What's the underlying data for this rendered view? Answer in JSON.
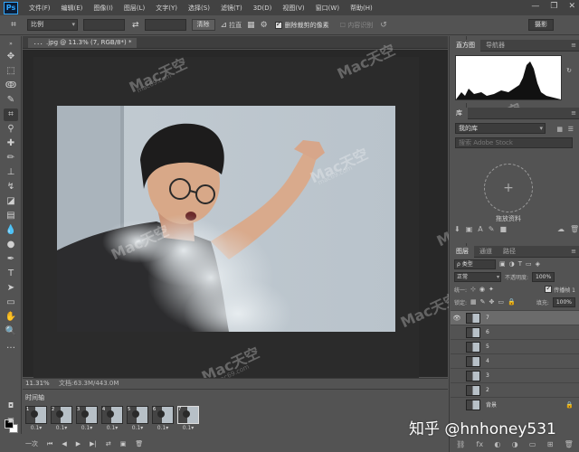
{
  "menu": {
    "logo": "Ps",
    "items": [
      "文件(F)",
      "编辑(E)",
      "图像(I)",
      "图层(L)",
      "文字(Y)",
      "选择(S)",
      "滤镜(T)",
      "3D(D)",
      "视图(V)",
      "窗口(W)",
      "帮助(H)"
    ],
    "window_buttons": [
      "—",
      "❐",
      "✕"
    ]
  },
  "options": {
    "ratio": "比例",
    "clear_label": "清除",
    "straighten_label": "拉直",
    "delete_cropped_label": "删除裁剪的像素",
    "delete_cropped_checked": true,
    "content_aware_label": "内容识别",
    "workspace": "摄影"
  },
  "document": {
    "tab_title": "．．．.jpg @ 11.3% (7, RGB/8*) *"
  },
  "status": {
    "zoom": "11.31%",
    "doc_size": "文档:63.3M/443.0M"
  },
  "timeline": {
    "tab_label": "时间轴",
    "frames": [
      {
        "num": "1",
        "delay": "0.1▾"
      },
      {
        "num": "2",
        "delay": "0.1▾"
      },
      {
        "num": "3",
        "delay": "0.1▾"
      },
      {
        "num": "4",
        "delay": "0.1▾"
      },
      {
        "num": "5",
        "delay": "0.1▾"
      },
      {
        "num": "6",
        "delay": "0.1▾"
      },
      {
        "num": "7",
        "delay": "0.1▾"
      }
    ],
    "loop": "一次",
    "controls": [
      "⏮",
      "◀",
      "▶",
      "▶|",
      "⇄",
      "▣",
      "🗑"
    ]
  },
  "histogram_panel": {
    "tabs": [
      "直方图",
      "导航器"
    ]
  },
  "library_panel": {
    "tab": "库",
    "library_name": "我的库",
    "search_placeholder": "搜索 Adobe Stock",
    "drop_label": "拖放资料"
  },
  "layers_panel": {
    "tabs": [
      "图层",
      "通道",
      "路径"
    ],
    "kind": "ρ 类型",
    "blend_mode": "正常",
    "opacity_label": "不透明度:",
    "opacity_value": "100%",
    "unify_label": "统一:",
    "propagate_label": "传播帧 1",
    "lock_label": "锁定:",
    "fill_label": "填充:",
    "fill_value": "100%",
    "layers": [
      {
        "name": "7",
        "visible": true,
        "selected": true,
        "locked": false
      },
      {
        "name": "6",
        "visible": false,
        "selected": false,
        "locked": false
      },
      {
        "name": "5",
        "visible": false,
        "selected": false,
        "locked": false
      },
      {
        "name": "4",
        "visible": false,
        "selected": false,
        "locked": false
      },
      {
        "name": "3",
        "visible": false,
        "selected": false,
        "locked": false
      },
      {
        "name": "2",
        "visible": false,
        "selected": false,
        "locked": false
      },
      {
        "name": "背景",
        "visible": false,
        "selected": false,
        "locked": true
      }
    ]
  },
  "watermarks": {
    "brand": "Mac天空",
    "site": "mac69.com",
    "zhihu": "知乎 @hnhoney531"
  }
}
